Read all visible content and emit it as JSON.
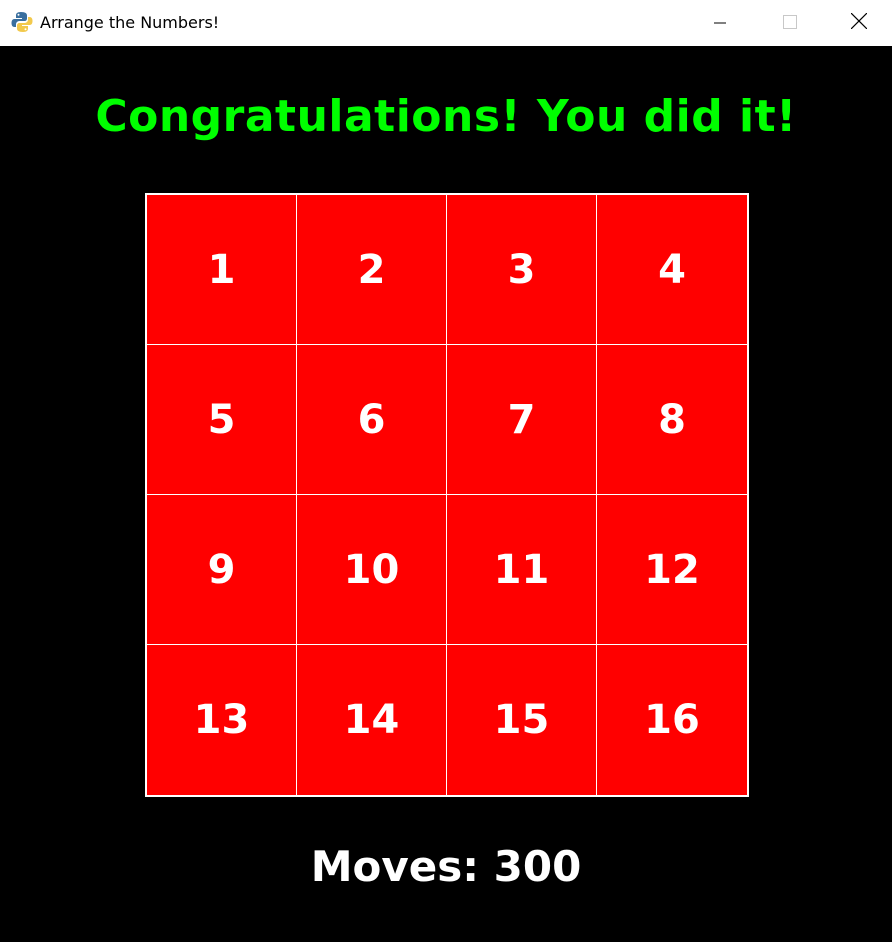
{
  "window": {
    "title": "Arrange the Numbers!",
    "icon": "python-snake-icon",
    "controls": [
      "minimize-icon",
      "maximize-icon",
      "close-icon"
    ]
  },
  "game": {
    "message": "Congratulations! You did it!",
    "message_color": "#00ff00",
    "tile_color": "#ff0000",
    "tile_text_color": "#ffffff",
    "grid_line_color": "#ffffff",
    "tiles": [
      "1",
      "2",
      "3",
      "4",
      "5",
      "6",
      "7",
      "8",
      "9",
      "10",
      "11",
      "12",
      "13",
      "14",
      "15",
      "16"
    ],
    "moves_label": "Moves:",
    "moves_value": "300"
  }
}
